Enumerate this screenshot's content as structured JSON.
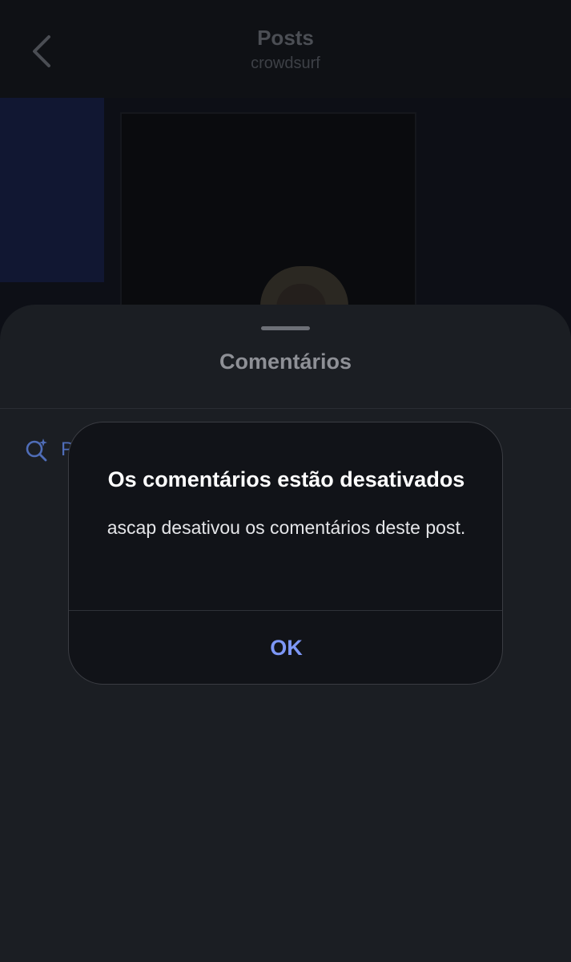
{
  "nav": {
    "title": "Posts",
    "subtitle": "crowdsurf",
    "back_icon": "chevron-left-icon"
  },
  "sheet": {
    "title": "Comentários",
    "search_icon": "ai-search-sparkle-icon",
    "search_text": "P"
  },
  "alert": {
    "title": "Os comentários estão desativados",
    "message": "ascap desativou os comentários deste post.",
    "ok_label": "OK"
  },
  "colors": {
    "background": "#0b0d11",
    "sheet": "#1b1e23",
    "alert": "#111318",
    "accent": "#7d97f6"
  }
}
